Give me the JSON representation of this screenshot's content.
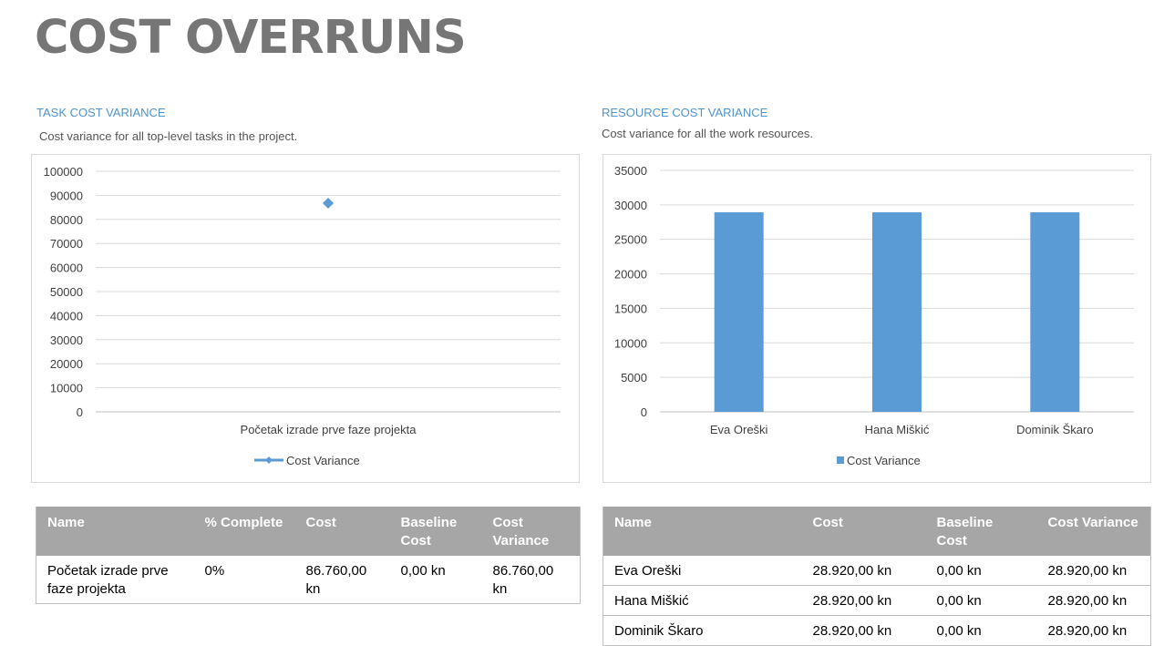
{
  "page": {
    "title": "COST OVERRUNS"
  },
  "task_section": {
    "title": "TASK COST VARIANCE",
    "description": "Cost variance for all top-level tasks in the project."
  },
  "resource_section": {
    "title": "RESOURCE COST VARIANCE",
    "description": "Cost variance for all the work resources."
  },
  "colors": {
    "series": "#5b9bd5",
    "header": "#a6a6a6",
    "title": "#767676",
    "accent": "#4f94cd"
  },
  "chart_data": [
    {
      "type": "line",
      "categories": [
        "Početak izrade prve faze projekta"
      ],
      "series": [
        {
          "name": "Cost Variance",
          "values": [
            86760
          ]
        }
      ],
      "ylim": [
        0,
        100000
      ],
      "yticks": [
        "0",
        "10000",
        "20000",
        "30000",
        "40000",
        "50000",
        "60000",
        "70000",
        "80000",
        "90000",
        "100000"
      ],
      "grid": true,
      "legend": "bottom",
      "marker": "diamond"
    },
    {
      "type": "bar",
      "categories": [
        "Eva Oreški",
        "Hana Miškić",
        "Dominik Škaro"
      ],
      "series": [
        {
          "name": "Cost Variance",
          "values": [
            28920,
            28920,
            28920
          ]
        }
      ],
      "ylim": [
        0,
        35000
      ],
      "yticks": [
        "0",
        "5000",
        "10000",
        "15000",
        "20000",
        "25000",
        "30000",
        "35000"
      ],
      "grid": true,
      "legend": "bottom"
    }
  ],
  "task_table": {
    "headers": [
      "Name",
      "% Complete",
      "Cost",
      "Baseline Cost",
      "Cost Variance"
    ],
    "rows": [
      [
        "Početak izrade prve faze projekta",
        "0%",
        "86.760,00 kn",
        "0,00 kn",
        "86.760,00 kn"
      ]
    ]
  },
  "resource_table": {
    "headers": [
      "Name",
      "Cost",
      "Baseline Cost",
      "Cost Variance"
    ],
    "rows": [
      [
        "Eva Oreški",
        "28.920,00 kn",
        "0,00 kn",
        "28.920,00 kn"
      ],
      [
        "Hana Miškić",
        "28.920,00 kn",
        "0,00 kn",
        "28.920,00 kn"
      ],
      [
        "Dominik Škaro",
        "28.920,00 kn",
        "0,00 kn",
        "28.920,00 kn"
      ]
    ]
  }
}
